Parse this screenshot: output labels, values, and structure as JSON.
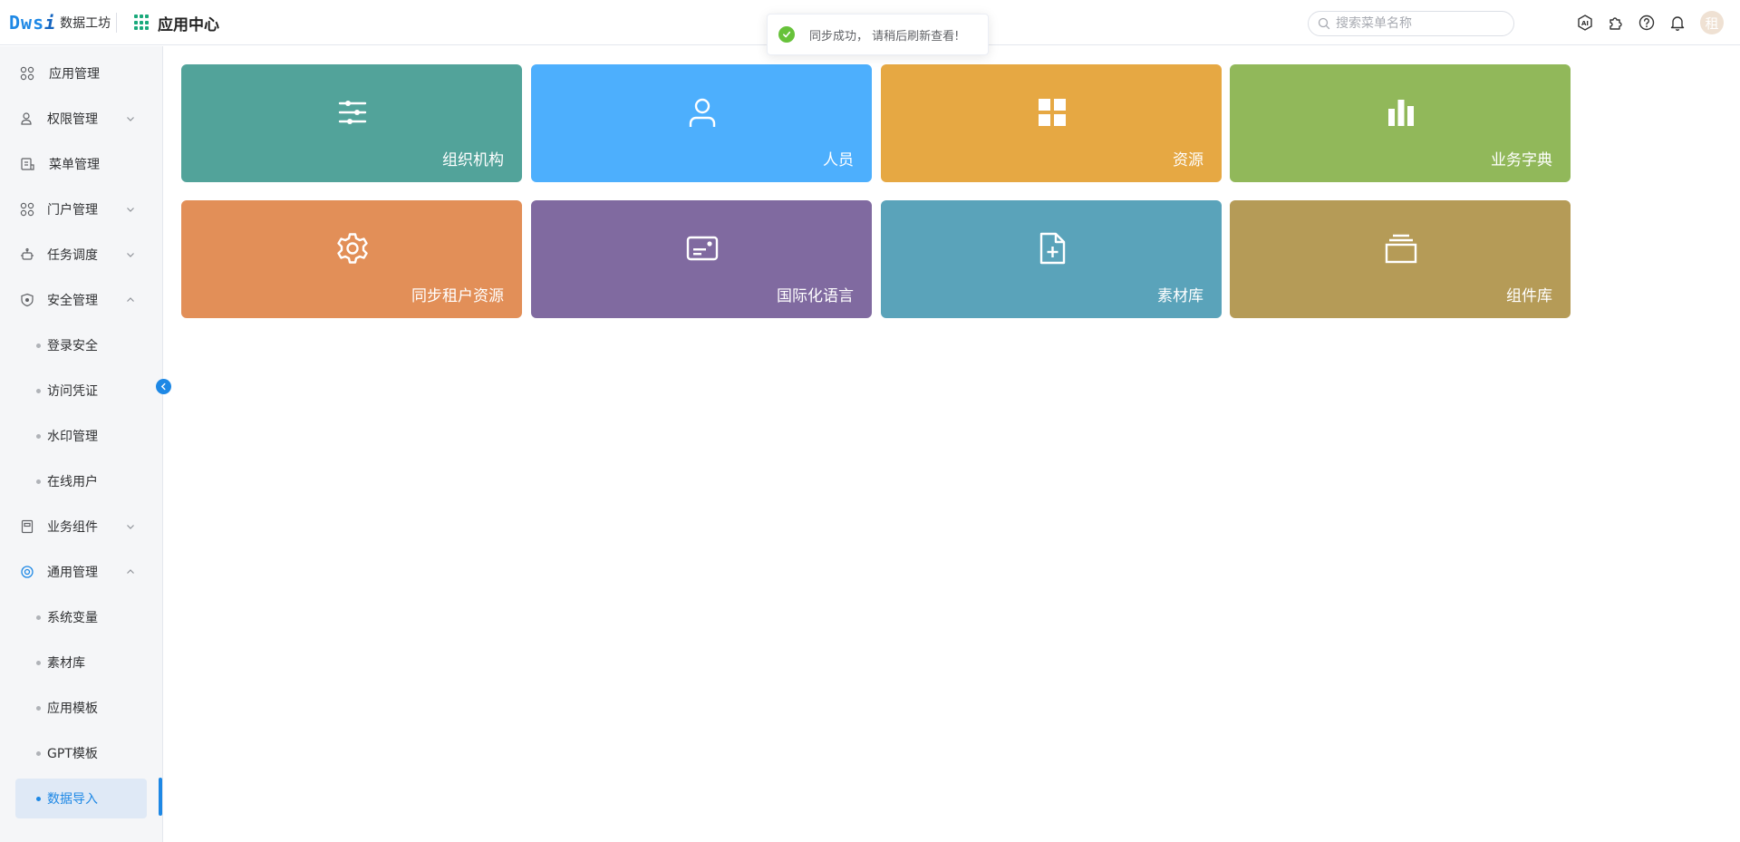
{
  "header": {
    "logo_mark": "Dws",
    "logo_mark_i": "i",
    "logo_text": "数据工坊",
    "app_center_title": "应用中心",
    "search_placeholder": "搜索菜单名称",
    "avatar_text": "租",
    "icons": [
      "ai-icon",
      "plugin-icon",
      "help-icon",
      "bell-icon"
    ]
  },
  "toast": {
    "text": "同步成功， 请稍后刷新查看!",
    "color": "#67c23a"
  },
  "sidebar": {
    "items": [
      {
        "label": "应用管理",
        "icon": "apps-icon"
      },
      {
        "label": "权限管理",
        "icon": "user-lock-icon",
        "expandable": true,
        "expanded": false
      },
      {
        "label": "菜单管理",
        "icon": "menu-doc-icon"
      },
      {
        "label": "门户管理",
        "icon": "portal-icon",
        "expandable": true,
        "expanded": false
      },
      {
        "label": "任务调度",
        "icon": "robot-icon",
        "expandable": true,
        "expanded": false
      },
      {
        "label": "安全管理",
        "icon": "shield-icon",
        "expandable": true,
        "expanded": true,
        "children": [
          "登录安全",
          "访问凭证",
          "水印管理",
          "在线用户"
        ]
      },
      {
        "label": "业务组件",
        "icon": "component-icon",
        "expandable": true,
        "expanded": false
      },
      {
        "label": "通用管理",
        "icon": "target-icon",
        "expandable": true,
        "expanded": true,
        "children": [
          "系统变量",
          "素材库",
          "应用模板",
          "GPT模板",
          "数据导入"
        ]
      }
    ],
    "active_item": "数据导入",
    "accent_color": "#1e88e5"
  },
  "tiles": [
    {
      "label": "组织机构",
      "icon": "sliders-icon",
      "color": "#52a39a"
    },
    {
      "label": "人员",
      "icon": "user-icon",
      "color": "#4daffd"
    },
    {
      "label": "资源",
      "icon": "grid-icon",
      "color": "#e6a843"
    },
    {
      "label": "业务字典",
      "icon": "bar-chart-icon",
      "color": "#91b85a"
    },
    {
      "label": "同步租户资源",
      "icon": "gear-icon",
      "color": "#e28f58"
    },
    {
      "label": "国际化语言",
      "icon": "id-card-icon",
      "color": "#806aa0"
    },
    {
      "label": "素材库",
      "icon": "file-plus-icon",
      "color": "#5aa3ba"
    },
    {
      "label": "组件库",
      "icon": "stack-icon",
      "color": "#b59b57"
    }
  ]
}
